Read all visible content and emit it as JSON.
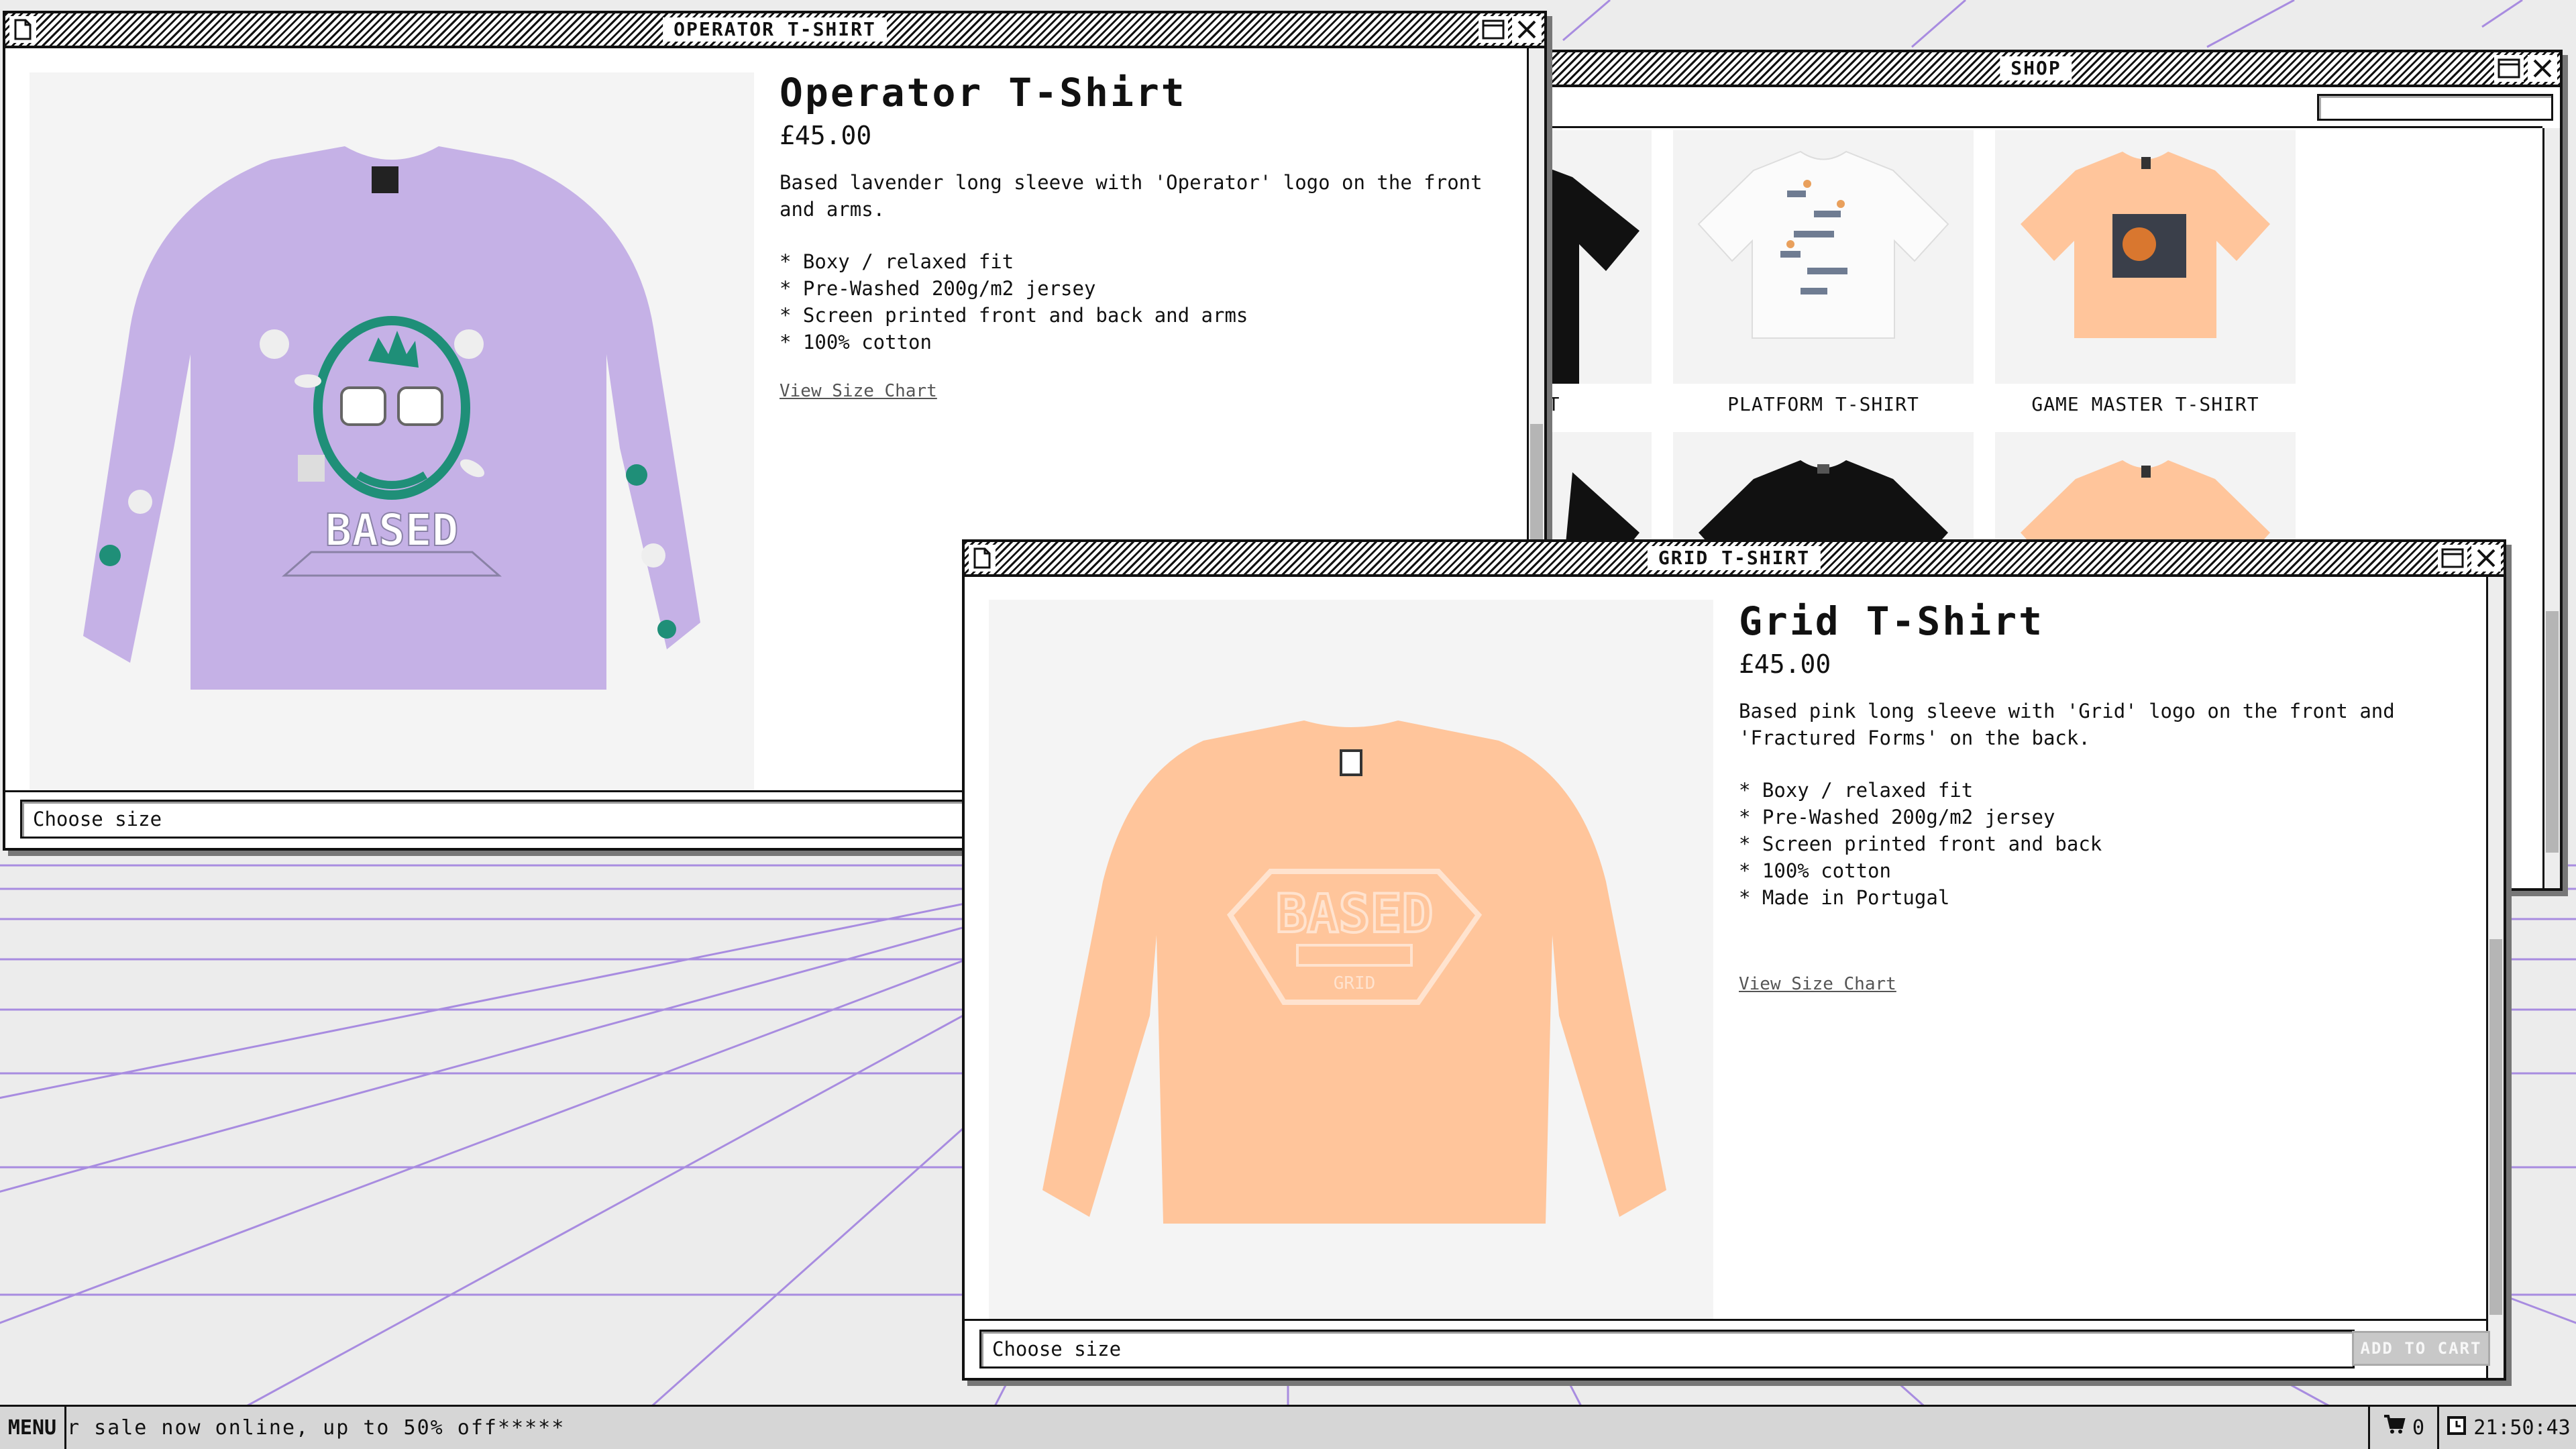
{
  "colors": {
    "grid_line": "#a88ce0",
    "lavender_shirt": "#c5b1e6",
    "peach_shirt": "#ffc59b",
    "teal_print": "#1f8f78",
    "black_shirt": "#111111"
  },
  "windows": {
    "operator": {
      "title": "OPERATOR T-SHIRT",
      "product": {
        "name": "Operator T-Shirt",
        "price": "£45.00",
        "description": "Based lavender long sleeve with 'Operator' logo on the front and arms.",
        "features": [
          "Boxy / relaxed fit",
          "Pre-Washed 200g/m2 jersey",
          "Screen printed front and back and arms",
          "100% cotton"
        ],
        "size_chart_link": "View Size Chart",
        "size_select": "Choose size"
      }
    },
    "shop": {
      "title": "SHOP",
      "search_value": "",
      "items": [
        {
          "label": "HIRT"
        },
        {
          "label": "PLATFORM T-SHIRT"
        },
        {
          "label": "GAME MASTER T-SHIRT"
        }
      ]
    },
    "grid": {
      "title": "GRID T-SHIRT",
      "product": {
        "name": "Grid T-Shirt",
        "price": "£45.00",
        "description": "Based pink long sleeve with 'Grid' logo on the front and 'Fractured Forms' on the back.",
        "features": [
          "Boxy / relaxed fit",
          "Pre-Washed 200g/m2 jersey",
          "Screen printed front and back",
          "100% cotton",
          "Made in Portugal"
        ],
        "size_chart_link": "View Size Chart",
        "size_select": "Choose size",
        "add_to_cart": "ADD TO CART"
      }
    }
  },
  "taskbar": {
    "menu": "MENU",
    "ticker": "r sale now online, up to 50% off*****",
    "cart_count": "0",
    "clock": "21:50:43"
  },
  "icons": {
    "title_doc": "document-icon",
    "maximize": "maximize-icon",
    "close": "close-icon",
    "cart": "cart-icon",
    "clock": "clock-icon"
  }
}
